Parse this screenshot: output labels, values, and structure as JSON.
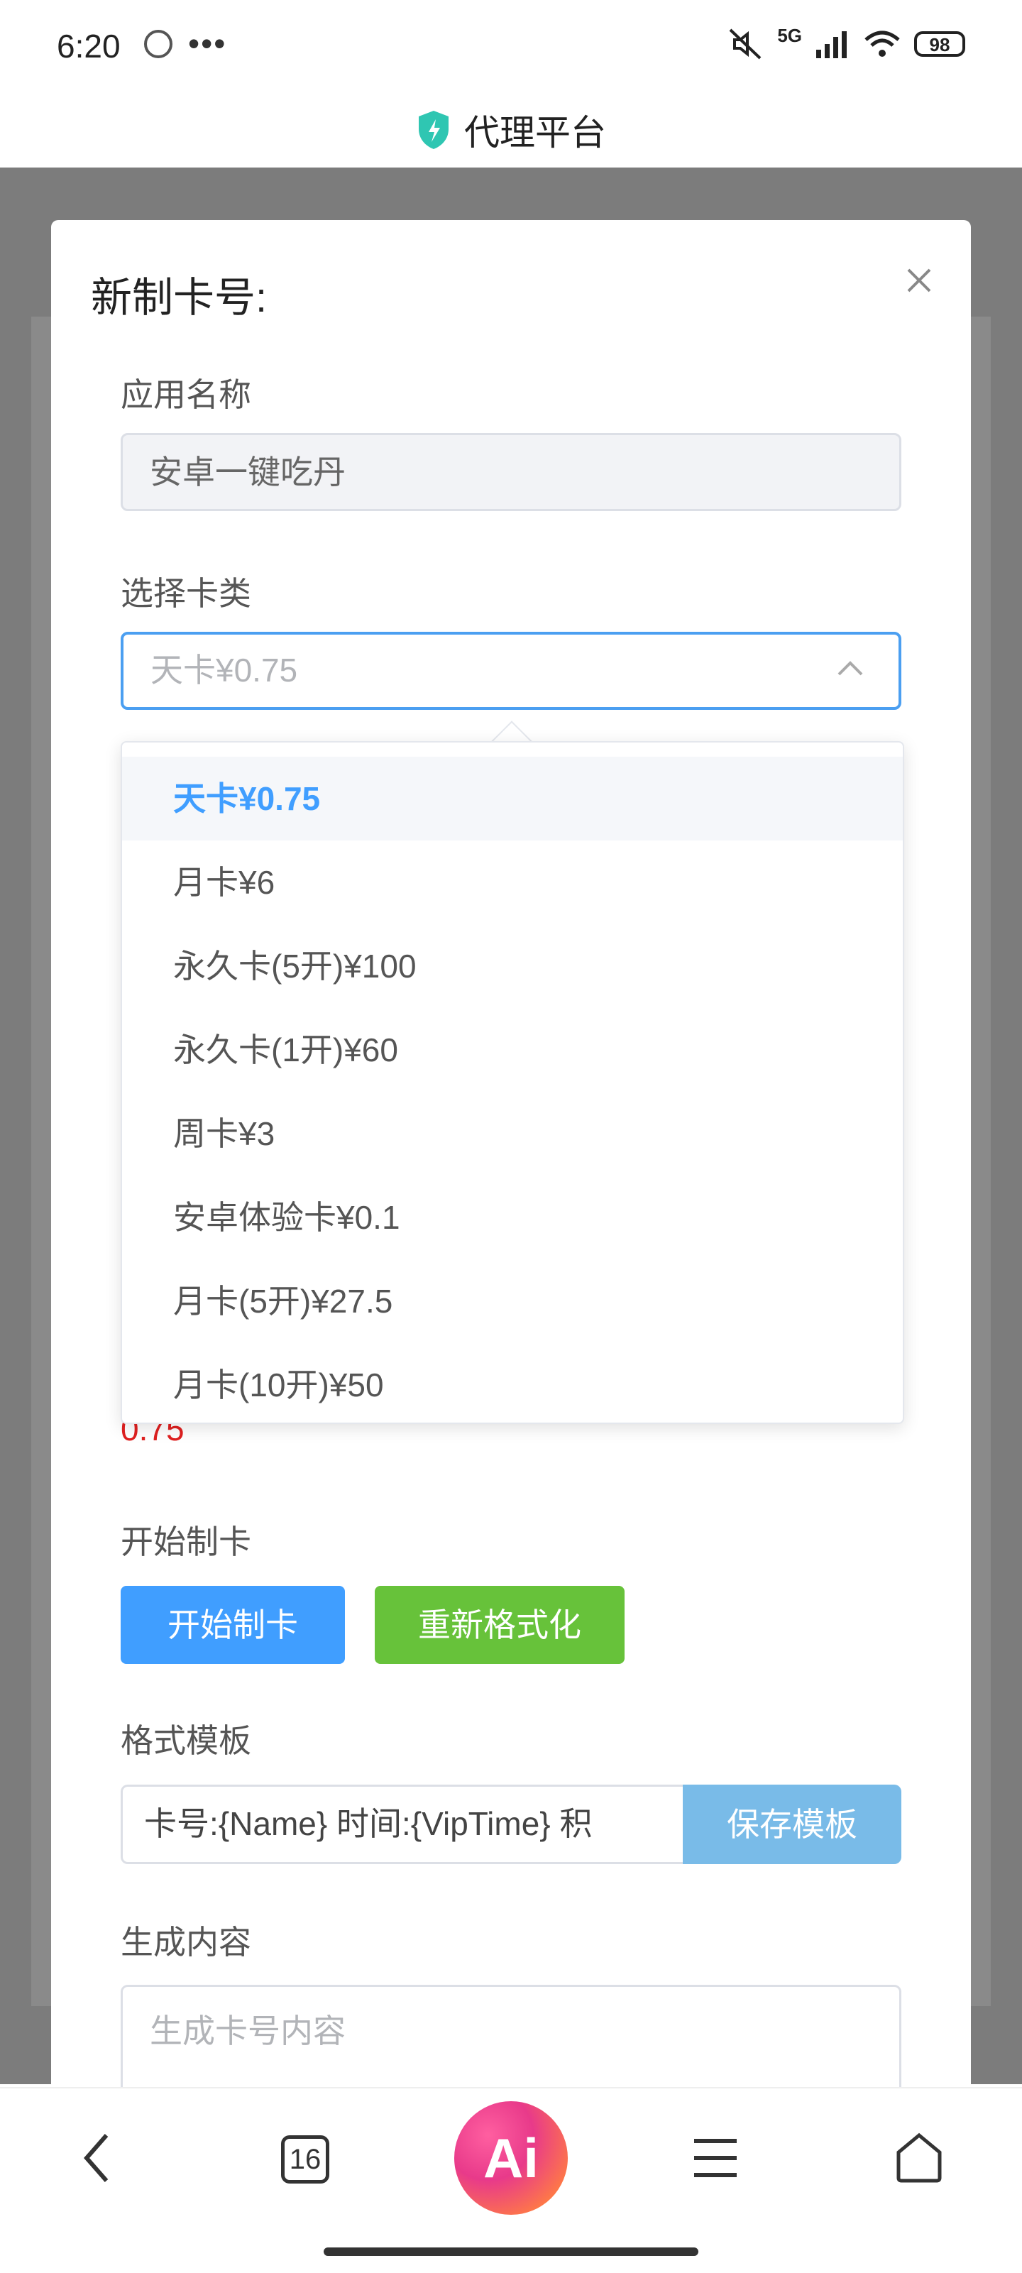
{
  "status_bar": {
    "time": "6:20",
    "more": "•••",
    "network": "5G",
    "battery": "98"
  },
  "header": {
    "title": "代理平台"
  },
  "modal": {
    "title": "新制卡号:",
    "app_name_label": "应用名称",
    "app_name_value": "安卓一键吃丹",
    "card_type_label": "选择卡类",
    "card_type_selected": "天卡¥0.75",
    "price_value": "0.75",
    "start_section_label": "开始制卡",
    "start_button": "开始制卡",
    "reformat_button": "重新格式化",
    "template_label": "格式模板",
    "template_value": "卡号:{Name} 时间:{VipTime} 积",
    "save_template_button": "保存模板",
    "content_label": "生成内容",
    "content_placeholder": "生成卡号内容"
  },
  "dropdown": {
    "options": [
      {
        "label": "天卡¥0.75",
        "selected": true
      },
      {
        "label": "月卡¥6",
        "selected": false
      },
      {
        "label": "永久卡(5开)¥100",
        "selected": false
      },
      {
        "label": "永久卡(1开)¥60",
        "selected": false
      },
      {
        "label": "周卡¥3",
        "selected": false
      },
      {
        "label": "安卓体验卡¥0.1",
        "selected": false
      },
      {
        "label": "月卡(5开)¥27.5",
        "selected": false
      },
      {
        "label": "月卡(10开)¥50",
        "selected": false
      }
    ]
  },
  "bottom_nav": {
    "tabs_count": "16",
    "ai_label": "Ai"
  },
  "colors": {
    "accent": "#409eff",
    "green": "#67c23a",
    "danger": "#e02020"
  }
}
